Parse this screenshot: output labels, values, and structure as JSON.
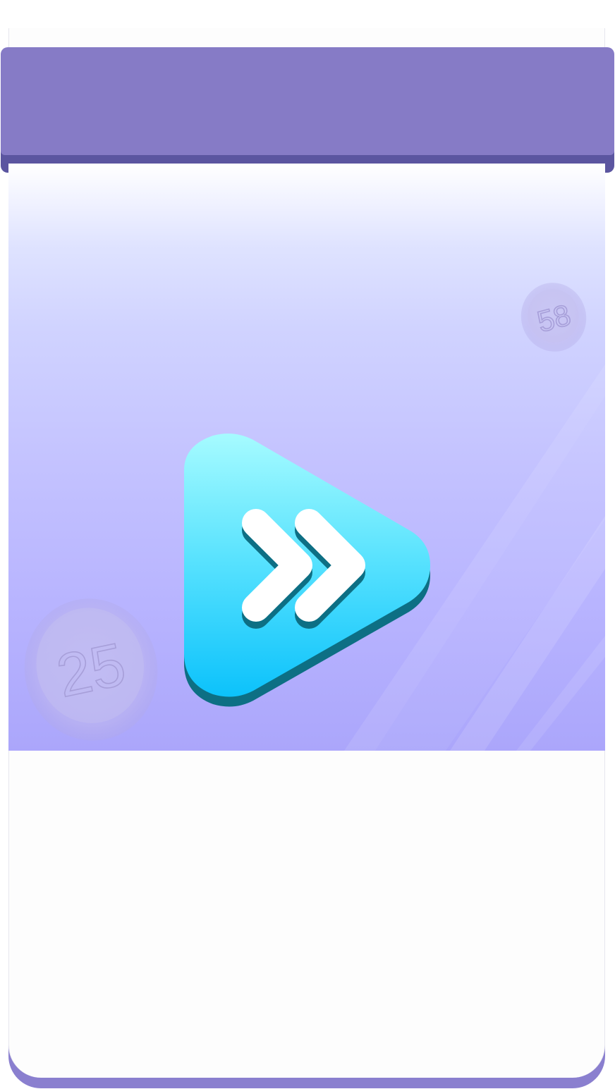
{
  "game": {
    "icon": "fast-forward-play-icon",
    "coins": [
      {
        "icon": "coin-icon",
        "label": "25"
      },
      {
        "icon": "coin-icon",
        "label": "58"
      }
    ]
  },
  "colors": {
    "header": "#867bc6",
    "header_shadow": "#5b55a0",
    "card_border": "#8a7fcf",
    "play_top": "#a6fbff",
    "play_bottom": "#0cc2fb",
    "play_shadow": "#0d6f84"
  }
}
